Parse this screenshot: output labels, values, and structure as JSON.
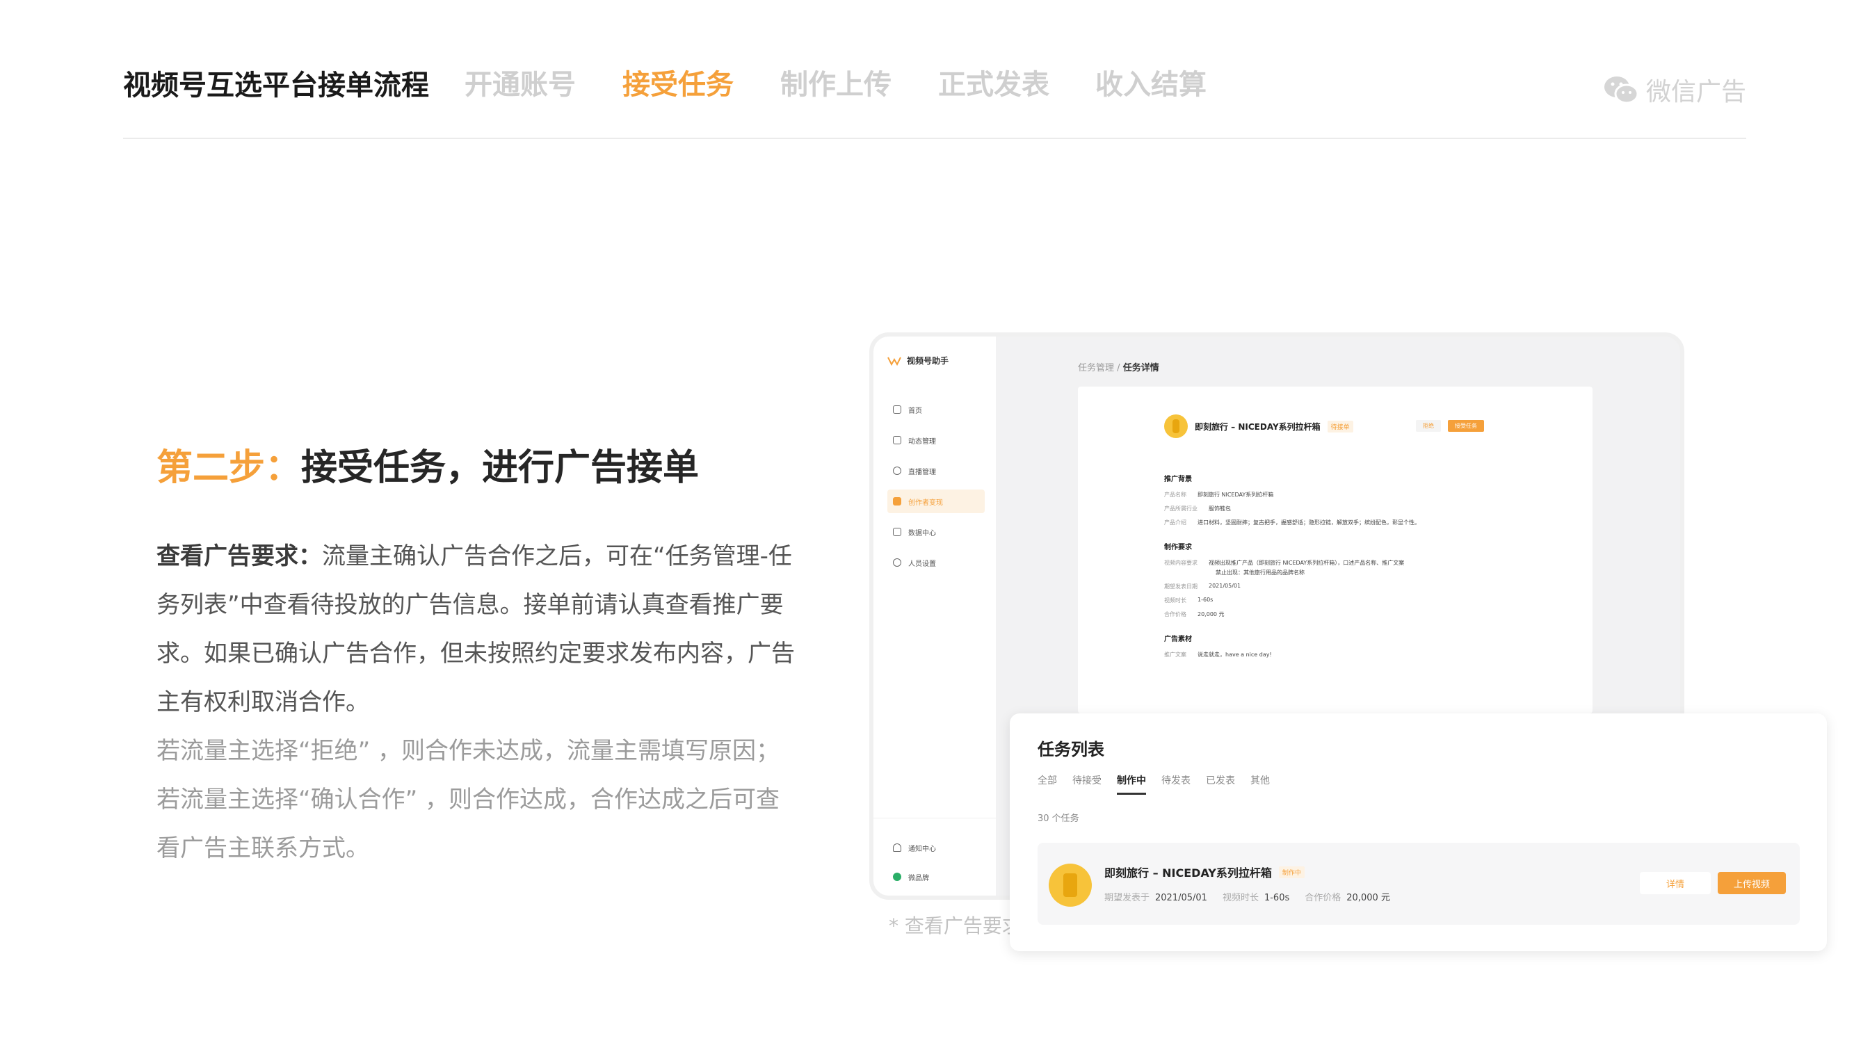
{
  "header": {
    "title": "视频号互选平台接单流程",
    "steps": [
      "开通账号",
      "接受任务",
      "制作上传",
      "正式发表",
      "收入结算"
    ],
    "active_step": "接受任务",
    "brand": "微信广告"
  },
  "section": {
    "step_label": "第二步：",
    "heading": "接受任务，进行广告接单",
    "lead": "查看广告要求：",
    "body": "流量主确认广告合作之后，可在“任务管理-任务列表”中查看待投放的广告信息。接单前请认真查看推广要求。如果已确认广告合作，但未按照约定要求发布内容，广告主有权利取消合作。",
    "note": "若流量主选择“拒绝” ，则合作未达成，流量主需填写原因；若流量主选择“确认合作” ，则合作达成，合作达成之后可查看广告主联系方式。"
  },
  "mockup": {
    "app_title": "视频号助手",
    "nav": [
      "首页",
      "动态管理",
      "直播管理",
      "创作者变现",
      "数据中心",
      "人员设置"
    ],
    "nav_bottom": [
      "通知中心",
      "微品牌"
    ],
    "breadcrumb_parent": "任务管理",
    "breadcrumb_sep": "/",
    "breadcrumb_current": "任务详情",
    "product_name": "即刻旅行 – NICEDAY系列拉杆箱",
    "status_tag": "待接单",
    "btn_reject": "拒绝",
    "btn_accept": "接受任务",
    "sections": {
      "background": "推广背景",
      "requirements": "制作要求",
      "material": "广告素材"
    },
    "fields": {
      "product_label": "产品名称",
      "product_value": "即刻旅行 NICEDAY系列拉杆箱",
      "industry_label": "产品所属行业",
      "industry_value": "服饰鞋包",
      "intro_label": "产品介绍",
      "intro_value": "进口材料，坚固耐摔；复古把手，握感舒适；隐形拉链，解放双手；缤纷配色，彰显个性。",
      "content_label": "视频内容要求",
      "content_value": "视频出现推广产品（即刻旅行 NICEDAY系列拉杆箱），口述产品名称、推广文案",
      "content_value2": "禁止出现：其他旅行用品的品牌名称",
      "date_label": "期望发表日期",
      "date_value": "2021/05/01",
      "duration_label": "视频时长",
      "duration_value": "1-60s",
      "price_label": "合作价格",
      "price_value": "20,000 元",
      "copy_label": "推广文案",
      "copy_value": "说走就走，have a nice day!"
    }
  },
  "task_list": {
    "title": "任务列表",
    "tabs": [
      "全部",
      "待接受",
      "制作中",
      "待发表",
      "已发表",
      "其他"
    ],
    "active_tab": "制作中",
    "count": "30 个任务",
    "item": {
      "name": "即刻旅行 – NICEDAY系列拉杆箱",
      "status": "制作中",
      "date_label": "期望发表于",
      "date": "2021/05/01",
      "duration_label": "视频时长",
      "duration": "1-60s",
      "price_label": "合作价格",
      "price": "20,000 元",
      "btn_detail": "详情",
      "btn_upload": "上传视频"
    }
  },
  "caption": "* 查看广告要求",
  "colors": {
    "accent": "#f5a03a",
    "inactive_step": "#cfcfcf",
    "heading": "#262626"
  },
  "icons": [
    "wechat-icon",
    "app-logo-icon",
    "home-icon",
    "camera-icon",
    "live-icon",
    "monetize-icon",
    "chart-icon",
    "users-icon",
    "bell-icon",
    "brand-icon"
  ]
}
